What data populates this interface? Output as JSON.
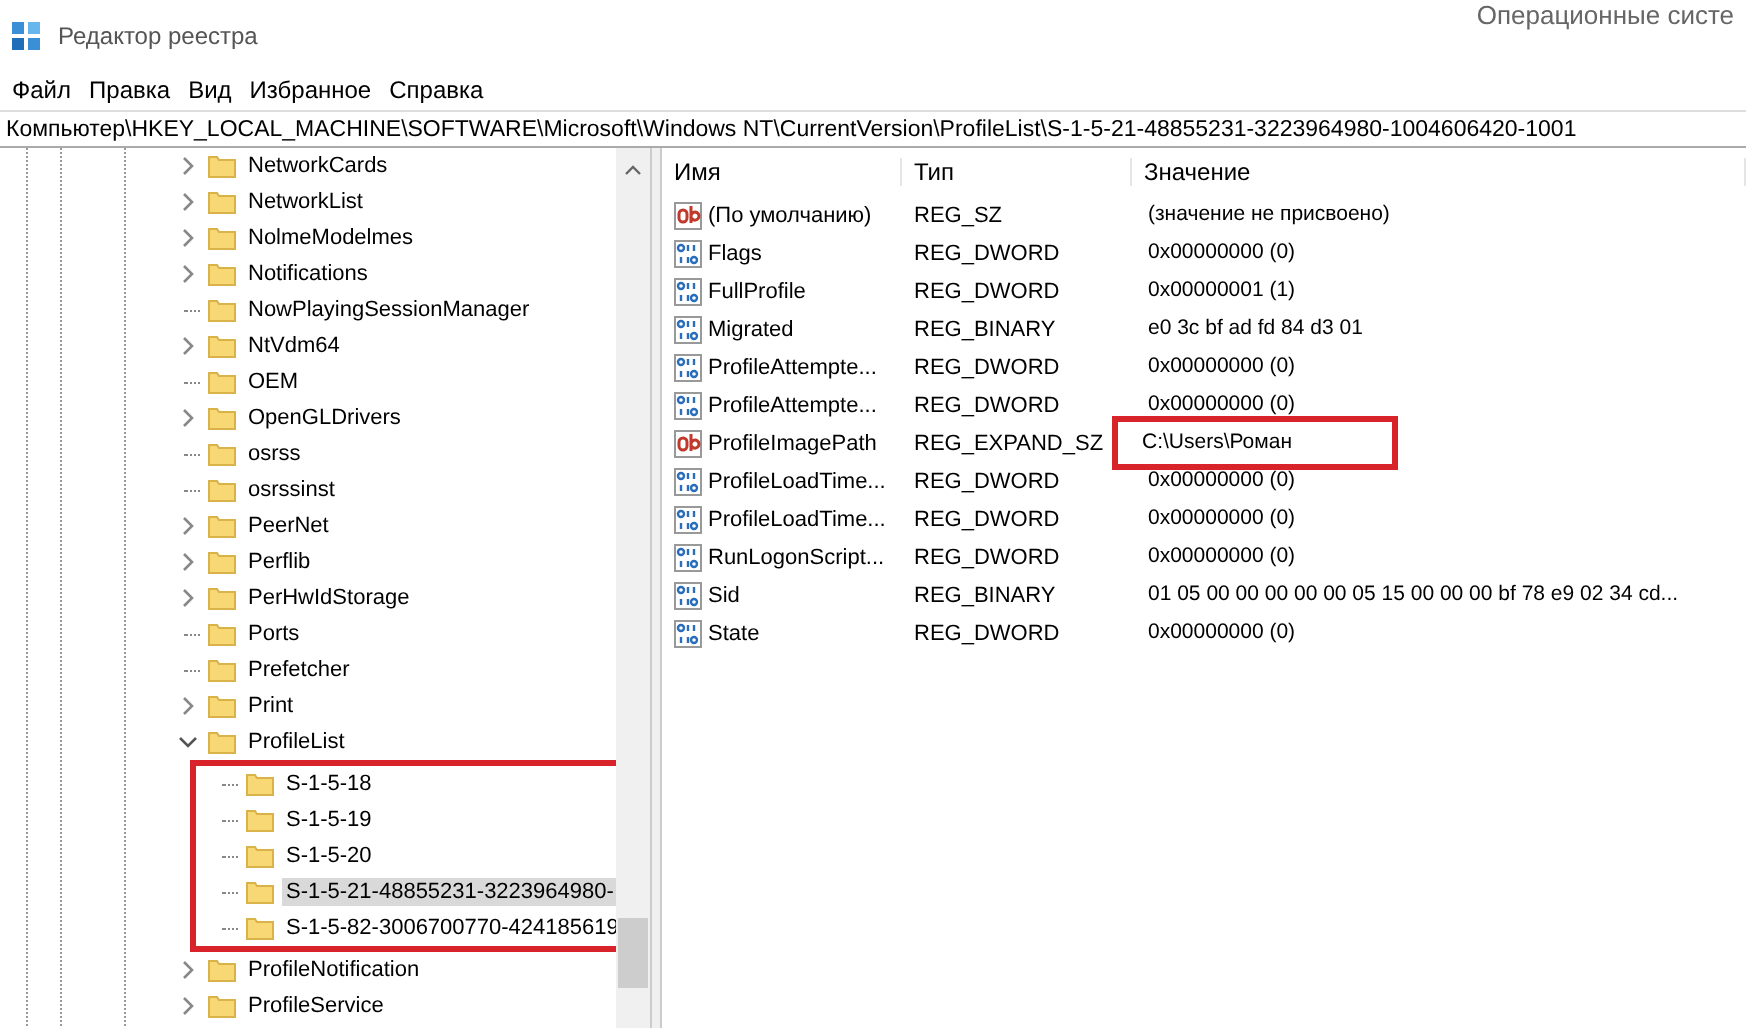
{
  "window": {
    "title": "Редактор реестра"
  },
  "background_text": "Операционные систе",
  "menu": [
    "Файл",
    "Правка",
    "Вид",
    "Избранное",
    "Справка"
  ],
  "address": "Компьютер\\HKEY_LOCAL_MACHINE\\SOFTWARE\\Microsoft\\Windows NT\\CurrentVersion\\ProfileList\\S-1-5-21-48855231-3223964980-1004606420-1001",
  "tree": [
    {
      "label": "NetworkCards",
      "kind": "collapsed",
      "selected": false
    },
    {
      "label": "NetworkList",
      "kind": "collapsed",
      "selected": false
    },
    {
      "label": "NolmeModelmes",
      "kind": "collapsed",
      "selected": false
    },
    {
      "label": "Notifications",
      "kind": "collapsed",
      "selected": false
    },
    {
      "label": "NowPlayingSessionManager",
      "kind": "leaf",
      "selected": false
    },
    {
      "label": "NtVdm64",
      "kind": "collapsed",
      "selected": false
    },
    {
      "label": "OEM",
      "kind": "leaf",
      "selected": false
    },
    {
      "label": "OpenGLDrivers",
      "kind": "collapsed",
      "selected": false
    },
    {
      "label": "osrss",
      "kind": "leaf",
      "selected": false
    },
    {
      "label": "osrssinst",
      "kind": "leaf",
      "selected": false
    },
    {
      "label": "PeerNet",
      "kind": "collapsed",
      "selected": false
    },
    {
      "label": "Perflib",
      "kind": "collapsed",
      "selected": false
    },
    {
      "label": "PerHwIdStorage",
      "kind": "collapsed",
      "selected": false
    },
    {
      "label": "Ports",
      "kind": "leaf",
      "selected": false
    },
    {
      "label": "Prefetcher",
      "kind": "leaf",
      "selected": false
    },
    {
      "label": "Print",
      "kind": "collapsed",
      "selected": false
    },
    {
      "label": "ProfileList",
      "kind": "expanded",
      "selected": false,
      "children_highlighted": true,
      "children": [
        {
          "label": "S-1-5-18",
          "kind": "leaf",
          "selected": false
        },
        {
          "label": "S-1-5-19",
          "kind": "leaf",
          "selected": false
        },
        {
          "label": "S-1-5-20",
          "kind": "leaf",
          "selected": false
        },
        {
          "label": "S-1-5-21-48855231-3223964980-",
          "kind": "leaf",
          "selected": true
        },
        {
          "label": "S-1-5-82-3006700770-424185619",
          "kind": "leaf",
          "selected": false
        }
      ]
    },
    {
      "label": "ProfileNotification",
      "kind": "collapsed",
      "selected": false
    },
    {
      "label": "ProfileService",
      "kind": "collapsed",
      "selected": false
    }
  ],
  "values": {
    "columns": [
      "Имя",
      "Тип",
      "Значение"
    ],
    "rows": [
      {
        "kind": "string",
        "name": "(По умолчанию)",
        "type": "REG_SZ",
        "value": "(значение не присвоено)",
        "highlighted": false
      },
      {
        "kind": "binary",
        "name": "Flags",
        "type": "REG_DWORD",
        "value": "0x00000000 (0)",
        "highlighted": false
      },
      {
        "kind": "binary",
        "name": "FullProfile",
        "type": "REG_DWORD",
        "value": "0x00000001 (1)",
        "highlighted": false
      },
      {
        "kind": "binary",
        "name": "Migrated",
        "type": "REG_BINARY",
        "value": "e0 3c bf ad fd 84 d3 01",
        "highlighted": false
      },
      {
        "kind": "binary",
        "name": "ProfileAttempte...",
        "type": "REG_DWORD",
        "value": "0x00000000 (0)",
        "highlighted": false
      },
      {
        "kind": "binary",
        "name": "ProfileAttempte...",
        "type": "REG_DWORD",
        "value": "0x00000000 (0)",
        "highlighted": false
      },
      {
        "kind": "string",
        "name": "ProfileImagePath",
        "type": "REG_EXPAND_SZ",
        "value": "C:\\Users\\Роман",
        "highlighted": true
      },
      {
        "kind": "binary",
        "name": "ProfileLoadTime...",
        "type": "REG_DWORD",
        "value": "0x00000000 (0)",
        "highlighted": false
      },
      {
        "kind": "binary",
        "name": "ProfileLoadTime...",
        "type": "REG_DWORD",
        "value": "0x00000000 (0)",
        "highlighted": false
      },
      {
        "kind": "binary",
        "name": "RunLogonScript...",
        "type": "REG_DWORD",
        "value": "0x00000000 (0)",
        "highlighted": false
      },
      {
        "kind": "binary",
        "name": "Sid",
        "type": "REG_BINARY",
        "value": "01 05 00 00 00 00 00 05 15 00 00 00 bf 78 e9 02 34 cd...",
        "highlighted": false
      },
      {
        "kind": "binary",
        "name": "State",
        "type": "REG_DWORD",
        "value": "0x00000000 (0)",
        "highlighted": false
      }
    ]
  }
}
